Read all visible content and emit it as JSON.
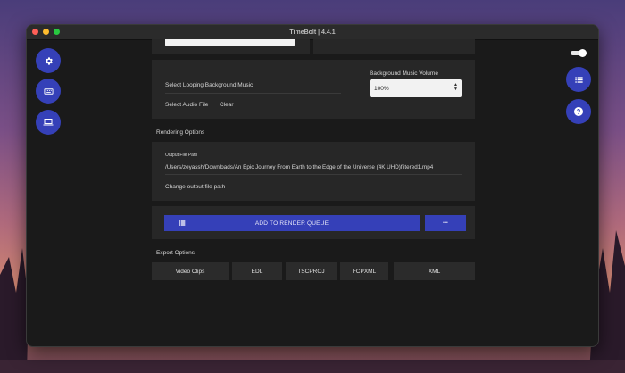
{
  "window": {
    "title": "TimeBolt | 4.4.1"
  },
  "left_nav": [
    {
      "icon": "gear-icon"
    },
    {
      "icon": "keyboard-icon"
    },
    {
      "icon": "laptop-icon"
    }
  ],
  "right_nav": [
    {
      "icon": "list-icon"
    },
    {
      "icon": "help-icon"
    }
  ],
  "music": {
    "select_label": "Select Looping Background Music",
    "volume_label": "Background Music Volume",
    "volume_value": "100%",
    "select_file": "Select Audio File",
    "clear": "Clear"
  },
  "rendering": {
    "heading": "Rendering Options",
    "output_label": "Output File Path",
    "output_path": "/Users/zeyassh/Downloads/An Epic Journey From Earth to the Edge of the Universe (4K UHD)filtered1.mp4",
    "change_path": "Change output file path"
  },
  "render_queue": {
    "label": "ADD TO RENDER QUEUE",
    "more": "•••"
  },
  "export": {
    "heading": "Export Options",
    "buttons": [
      "Video Clips",
      "EDL",
      "TSCPROJ",
      "FCPXML",
      "XML"
    ]
  }
}
